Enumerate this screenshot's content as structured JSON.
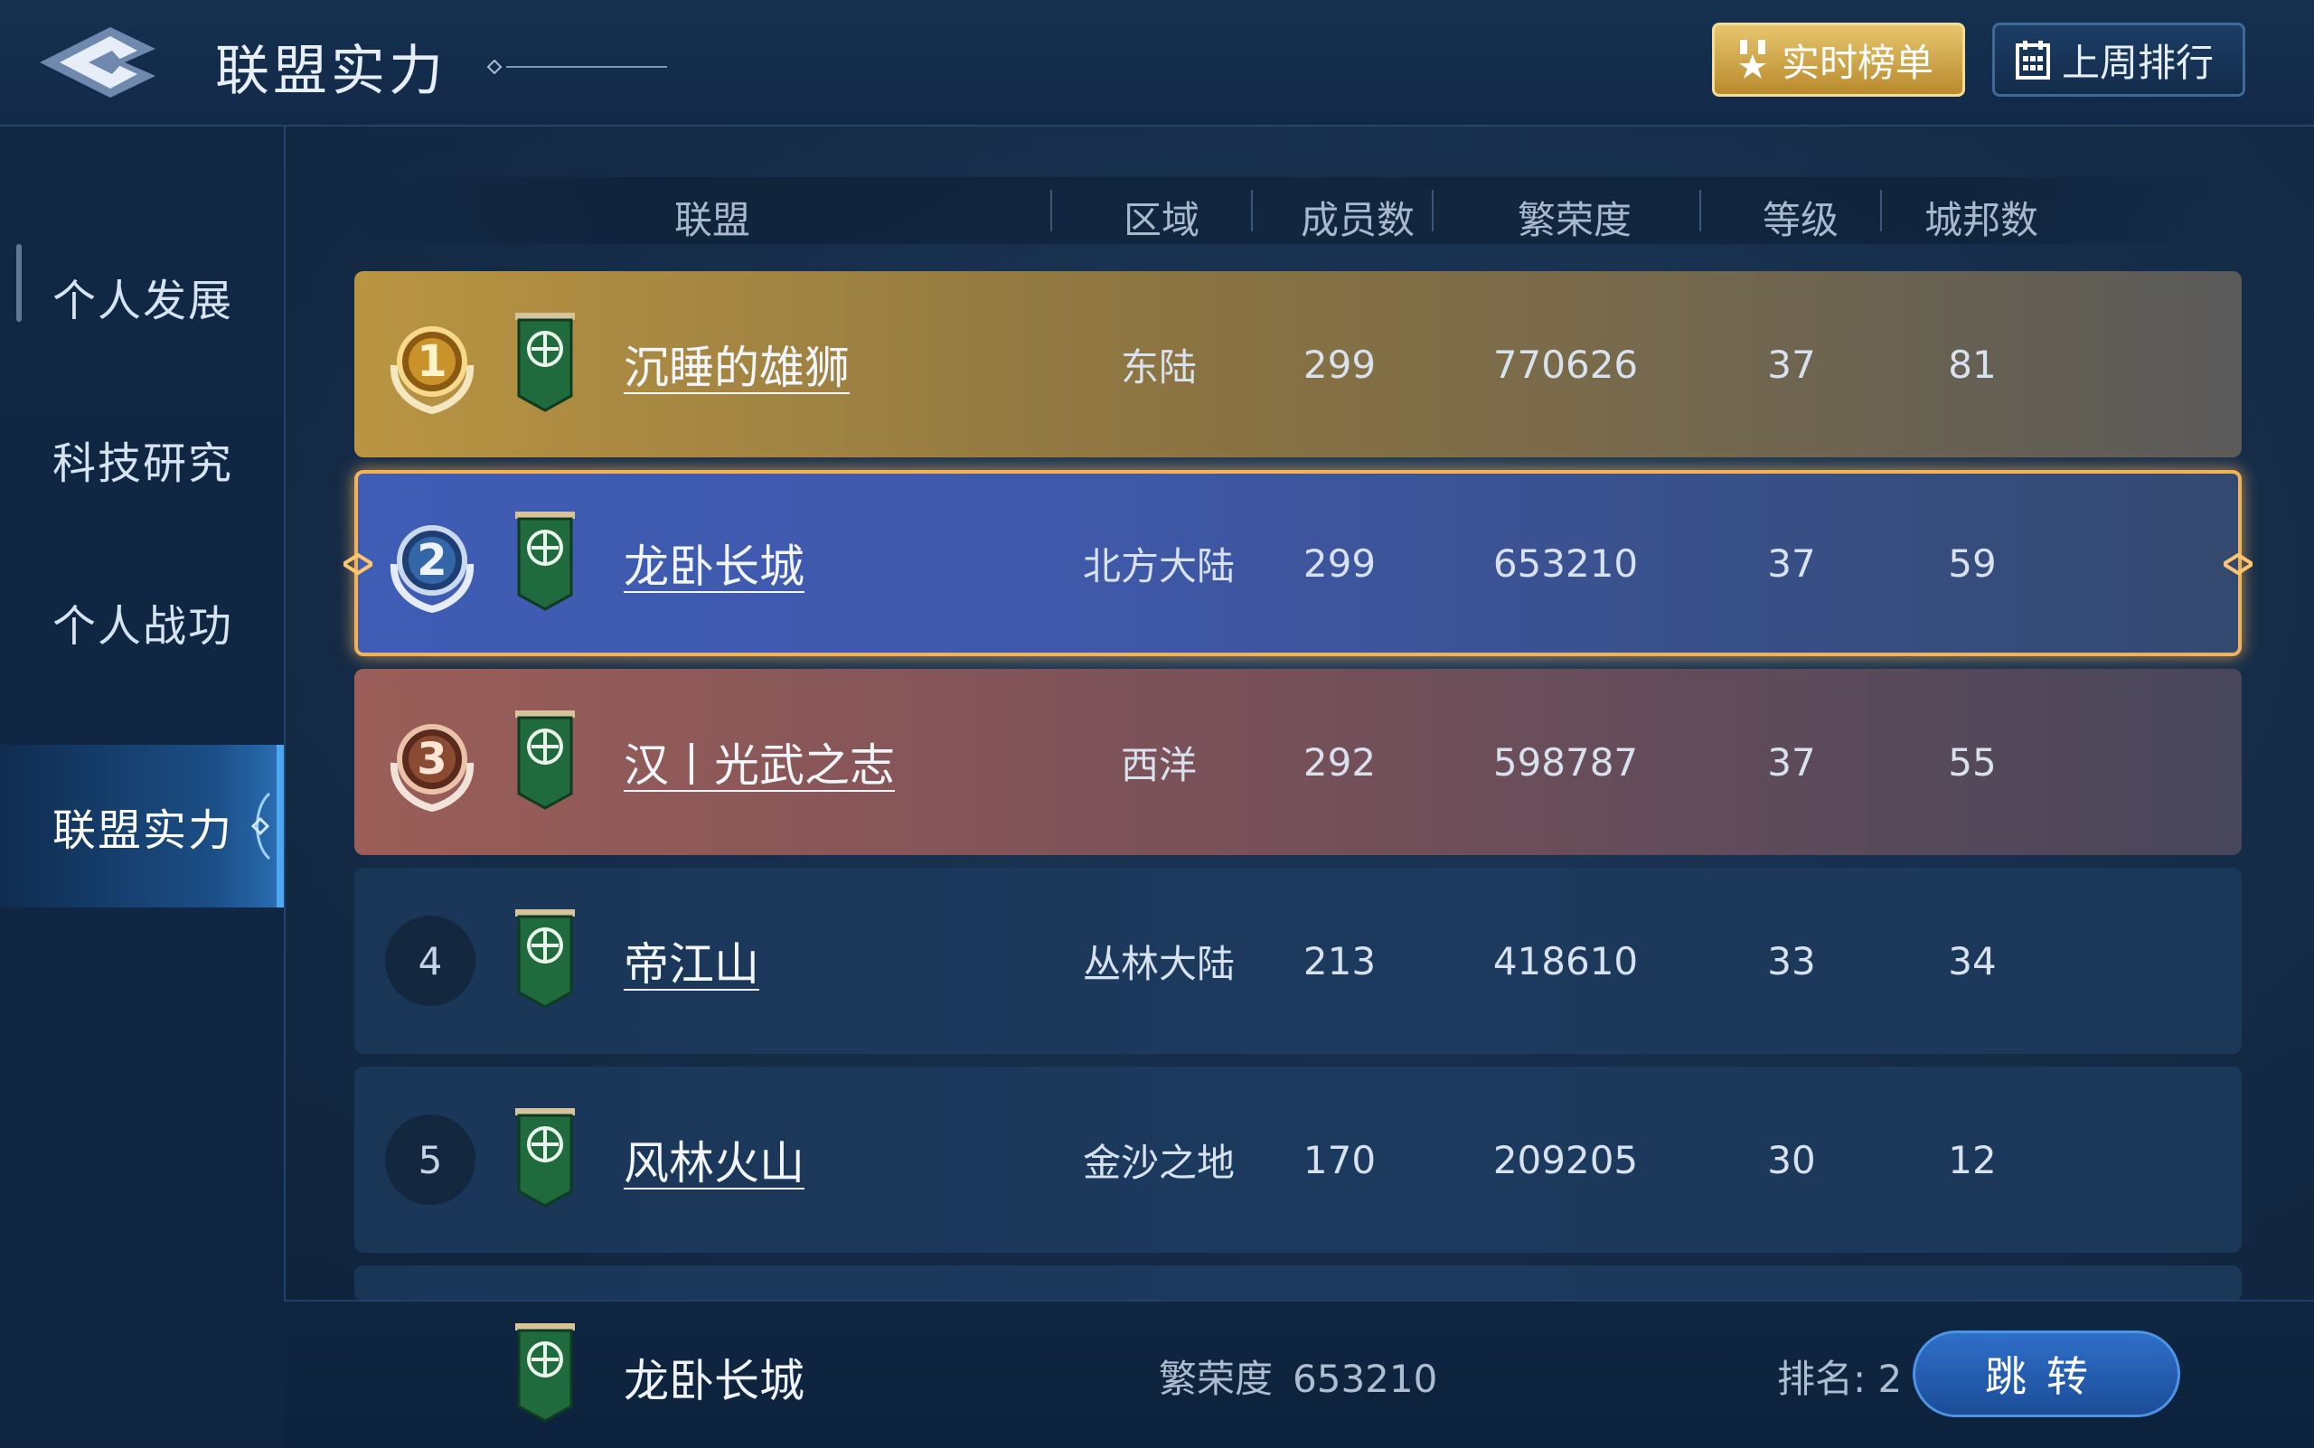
{
  "header": {
    "title": "联盟实力",
    "buttons": {
      "realtime": "实时榜单",
      "last_week": "上周排行"
    }
  },
  "sidebar": {
    "items": [
      {
        "label": "个人发展"
      },
      {
        "label": "科技研究"
      },
      {
        "label": "个人战功"
      },
      {
        "label": "联盟实力",
        "active": true
      }
    ]
  },
  "table": {
    "columns": {
      "alliance": "联盟",
      "region": "区域",
      "members": "成员数",
      "prosperity": "繁荣度",
      "level": "等级",
      "cities": "城邦数"
    },
    "rows": [
      {
        "rank": "1",
        "name": "沉睡的雄狮",
        "region": "东陆",
        "members": "299",
        "prosperity": "770626",
        "level": "37",
        "cities": "81"
      },
      {
        "rank": "2",
        "name": "龙卧长城",
        "region": "北方大陆",
        "members": "299",
        "prosperity": "653210",
        "level": "37",
        "cities": "59",
        "selected": true
      },
      {
        "rank": "3",
        "name": "汉丨光武之志",
        "region": "西洋",
        "members": "292",
        "prosperity": "598787",
        "level": "37",
        "cities": "55"
      },
      {
        "rank": "4",
        "name": "帝江山",
        "region": "丛林大陆",
        "members": "213",
        "prosperity": "418610",
        "level": "33",
        "cities": "34"
      },
      {
        "rank": "5",
        "name": "风林火山",
        "region": "金沙之地",
        "members": "170",
        "prosperity": "209205",
        "level": "30",
        "cities": "12"
      }
    ]
  },
  "footer": {
    "name": "龙卧长城",
    "prosperity_label": "繁荣度",
    "prosperity_value": "653210",
    "rank_label": "排名: 2",
    "jump_label": "跳转"
  },
  "colors": {
    "gold": "#b99542",
    "blue": "#3f5db5",
    "bronze": "#9b5e58",
    "highlight": "#f0b25a",
    "jump": "#2f6fc9"
  },
  "icons": [
    "back-arrow-icon",
    "medal-icon",
    "calendar-icon",
    "alliance-flag-icon",
    "rank-medal-icon"
  ]
}
